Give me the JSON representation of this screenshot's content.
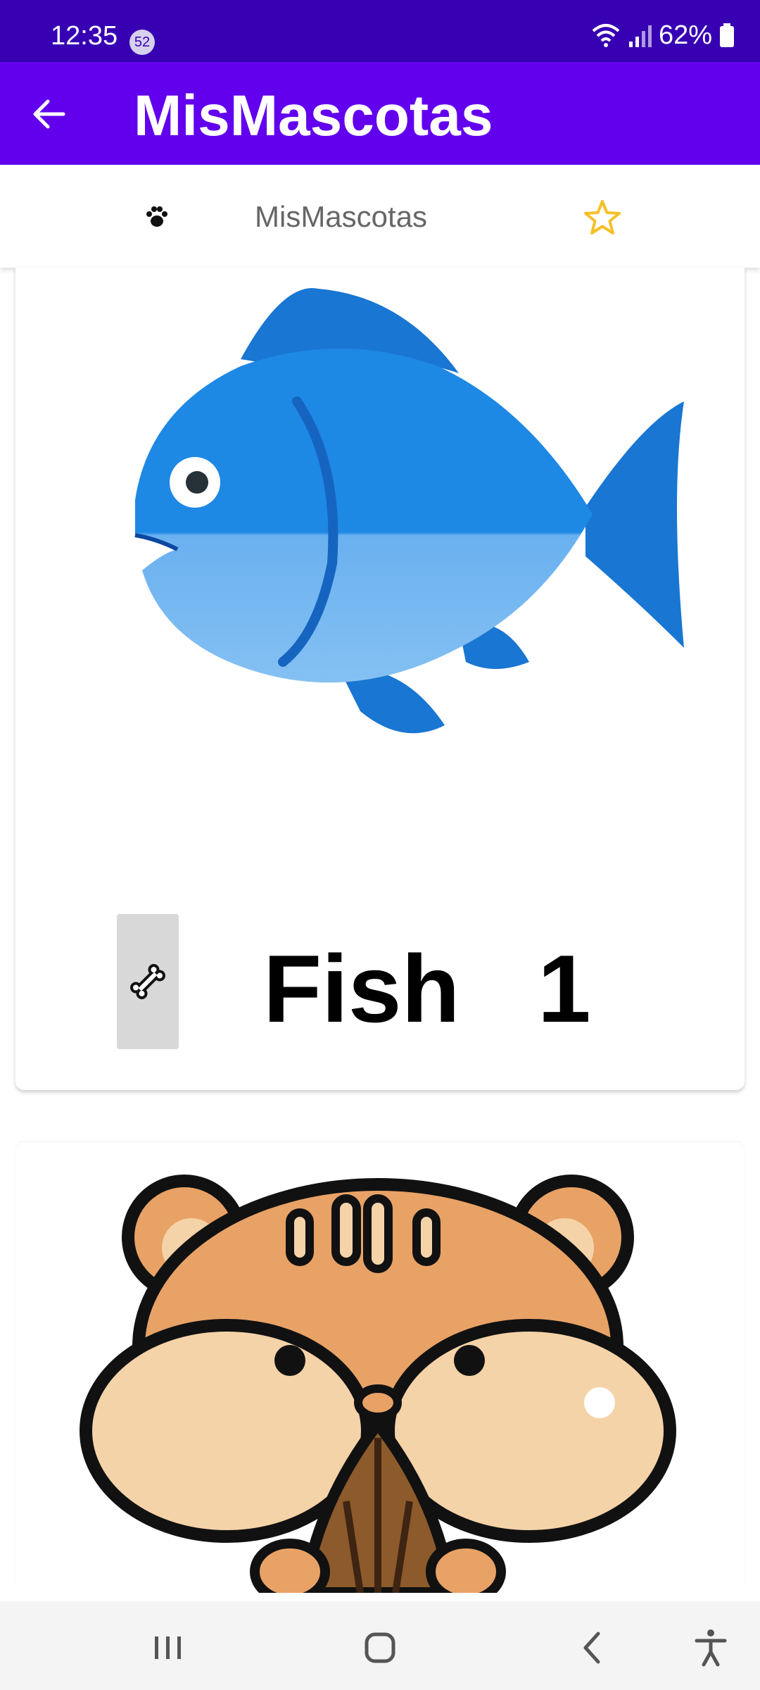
{
  "status_bar": {
    "time": "12:35",
    "notification_count": "52",
    "battery": "62%"
  },
  "app_bar": {
    "title": "MisMascotas",
    "back_icon": "arrow-back-icon"
  },
  "sub_bar": {
    "title": "MisMascotas",
    "left_icon": "paw-icon",
    "right_icon": "star-outline-icon",
    "star_color": "#f6c026"
  },
  "pets": [
    {
      "name": "Fish",
      "count": "1",
      "image": "fish-image",
      "action_icon": "bone-icon"
    },
    {
      "image": "hamster-image"
    }
  ],
  "colors": {
    "status_bar": "#3700b3",
    "app_bar": "#6200ee"
  },
  "nav_bar": {
    "icons": [
      "recents-icon",
      "home-icon",
      "back-icon",
      "accessibility-icon"
    ]
  }
}
